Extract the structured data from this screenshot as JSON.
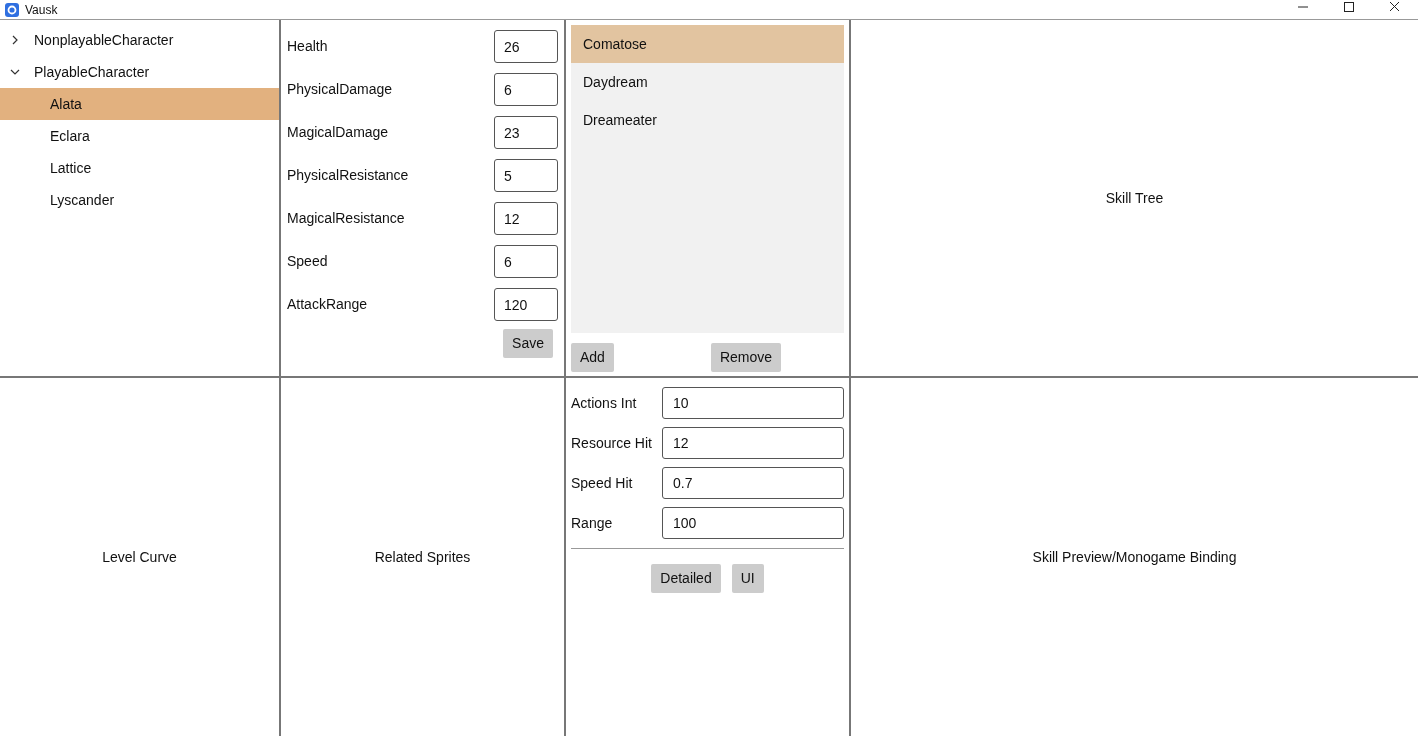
{
  "window": {
    "title": "Vausk"
  },
  "tree": [
    {
      "label": "NonplayableCharacter",
      "expanded": false
    },
    {
      "label": "PlayableCharacter",
      "expanded": true,
      "children": [
        {
          "label": "Alata",
          "selected": true
        },
        {
          "label": "Eclara",
          "selected": false
        },
        {
          "label": "Lattice",
          "selected": false
        },
        {
          "label": "Lyscander",
          "selected": false
        }
      ]
    }
  ],
  "stats": [
    {
      "label": "Health",
      "value": "26"
    },
    {
      "label": "PhysicalDamage",
      "value": "6"
    },
    {
      "label": "MagicalDamage",
      "value": "23"
    },
    {
      "label": "PhysicalResistance",
      "value": "5"
    },
    {
      "label": "MagicalResistance",
      "value": "12"
    },
    {
      "label": "Speed",
      "value": "6"
    },
    {
      "label": "AttackRange",
      "value": "120"
    }
  ],
  "save_button": "Save",
  "skills": [
    {
      "label": "Comatose",
      "selected": true
    },
    {
      "label": "Daydream",
      "selected": false
    },
    {
      "label": "Dreameater",
      "selected": false
    }
  ],
  "skill_buttons": [
    "Add",
    "Remove"
  ],
  "skill_tree": "Skill Tree",
  "level_curve": "Level Curve",
  "related_sprites": "Related Sprites",
  "skill_fields": [
    {
      "label": "Actions Int",
      "value": "10"
    },
    {
      "label": "Resource Hit",
      "value": "12"
    },
    {
      "label": "Speed Hit",
      "value": "0.7"
    },
    {
      "label": "Range",
      "value": "100"
    }
  ],
  "view_buttons": [
    "Detailed",
    "UI"
  ],
  "skill_preview": "Skill Preview/Monogame Binding"
}
